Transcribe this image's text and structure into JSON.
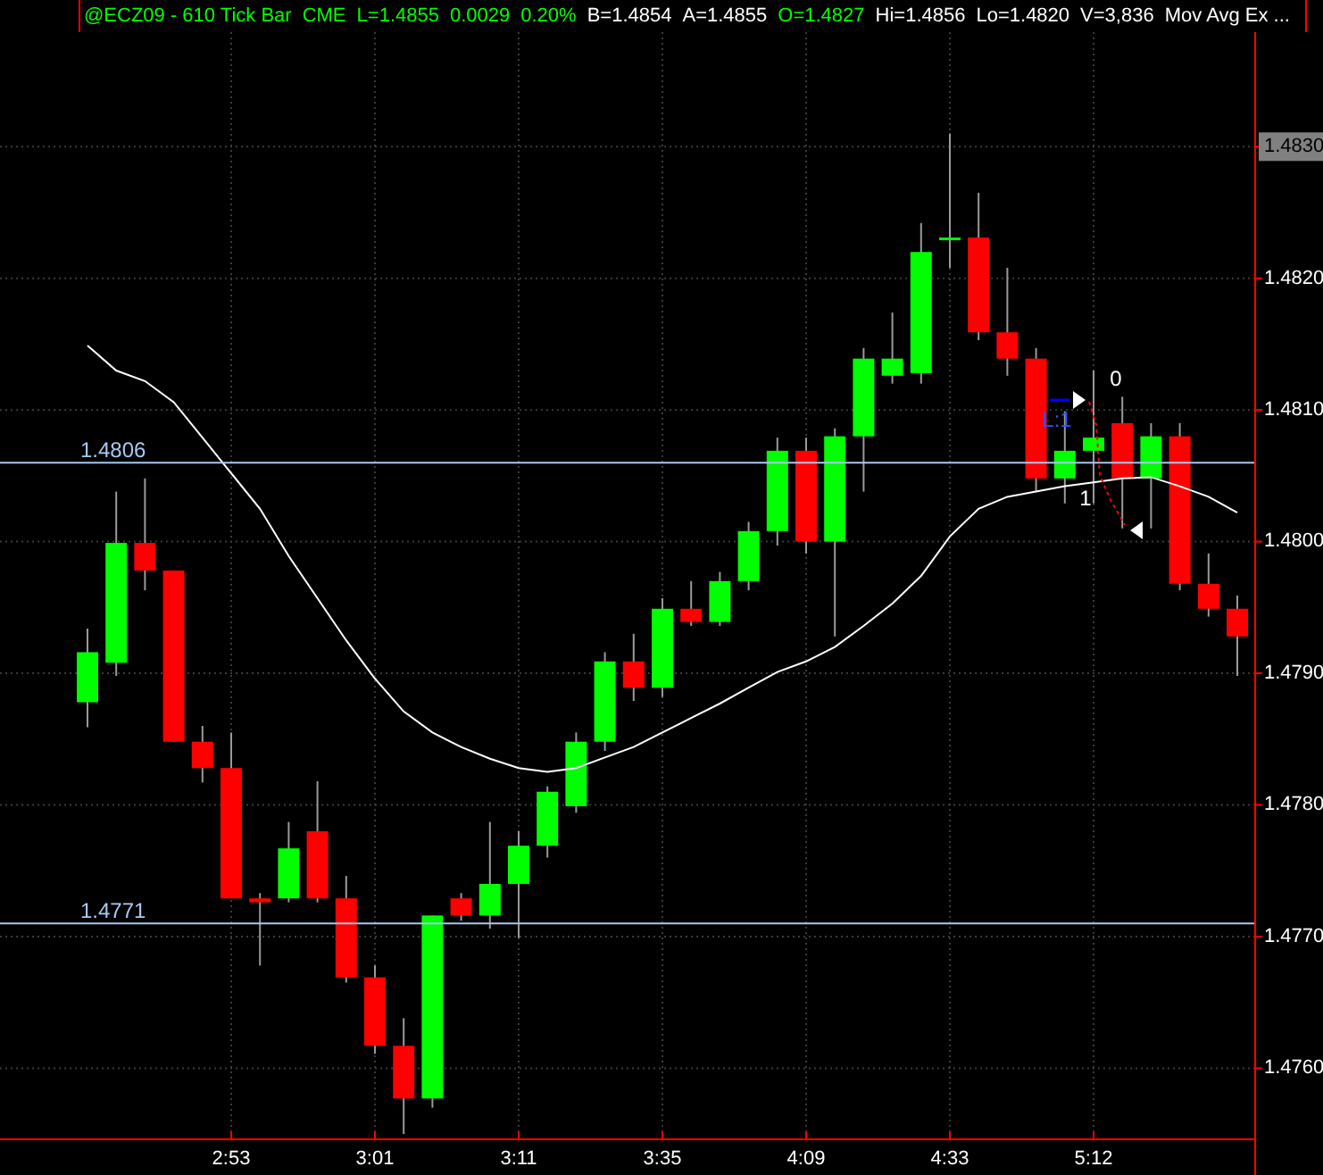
{
  "header": {
    "items": [
      {
        "text": "@ECZ09 - 610 Tick Bar",
        "color": "#00ff00"
      },
      {
        "text": "CME",
        "color": "#00ff00"
      },
      {
        "text": "L=1.4855",
        "color": "#00ff00"
      },
      {
        "text": "0.0029",
        "color": "#00ff00"
      },
      {
        "text": "0.20%",
        "color": "#00ff00"
      },
      {
        "text": "B=1.4854",
        "color": "#ffffff"
      },
      {
        "text": "A=1.4855",
        "color": "#ffffff"
      },
      {
        "text": "O=1.4827",
        "color": "#00ff00"
      },
      {
        "text": "Hi=1.4856",
        "color": "#ffffff"
      },
      {
        "text": "Lo=1.4820",
        "color": "#ffffff"
      },
      {
        "text": "V=3,836",
        "color": "#ffffff"
      },
      {
        "text": "Mov Avg Ex ...",
        "color": "#ffffff"
      }
    ]
  },
  "chart": {
    "chart_data": {
      "type": "candlestick",
      "ylim": [
        1.47546,
        1.48387
      ],
      "grid": true,
      "categories": [
        null,
        null,
        null,
        null,
        null,
        "2:53",
        null,
        null,
        null,
        null,
        "3:01",
        null,
        null,
        null,
        null,
        "3:11",
        null,
        null,
        null,
        null,
        "3:35",
        null,
        null,
        null,
        null,
        "4:09",
        null,
        null,
        null,
        null,
        "4:33",
        null,
        null,
        null,
        null,
        "5:12",
        null,
        null,
        null,
        null,
        null
      ],
      "yticks": [
        {
          "value": 1.476,
          "label": "1.4760"
        },
        {
          "value": 1.477,
          "label": "1.4770"
        },
        {
          "value": 1.478,
          "label": "1.4780"
        },
        {
          "value": 1.479,
          "label": "1.4790"
        },
        {
          "value": 1.48,
          "label": "1.4800"
        },
        {
          "value": 1.481,
          "label": "1.4810"
        },
        {
          "value": 1.482,
          "label": "1.4820"
        },
        {
          "value": 1.483,
          "label": "1.4830"
        }
      ],
      "ohlc": [
        [
          1.47878,
          1.47934,
          1.47859,
          1.47916
        ],
        [
          1.47908,
          1.48038,
          1.47898,
          1.47999
        ],
        [
          1.47999,
          1.48048,
          1.47963,
          1.47978
        ],
        [
          1.47978,
          1.47978,
          1.47848,
          1.47848
        ],
        [
          1.47848,
          1.4786,
          1.47817,
          1.47828
        ],
        [
          1.47828,
          1.47855,
          1.47729,
          1.47729
        ],
        [
          1.47729,
          1.47733,
          1.47678,
          1.47726
        ],
        [
          1.47729,
          1.47787,
          1.47726,
          1.47767
        ],
        [
          1.4778,
          1.47818,
          1.47726,
          1.47729
        ],
        [
          1.47729,
          1.47746,
          1.47665,
          1.47669
        ],
        [
          1.47669,
          1.47678,
          1.47611,
          1.47617
        ],
        [
          1.47617,
          1.47638,
          1.4755,
          1.47577
        ],
        [
          1.47577,
          1.47716,
          1.4757,
          1.47716
        ],
        [
          1.47729,
          1.47733,
          1.47712,
          1.47716
        ],
        [
          1.47716,
          1.47787,
          1.47706,
          1.4774
        ],
        [
          1.4774,
          1.4778,
          1.47699,
          1.47769
        ],
        [
          1.47769,
          1.47814,
          1.4776,
          1.4781
        ],
        [
          1.47799,
          1.47855,
          1.47794,
          1.47848
        ],
        [
          1.47848,
          1.47916,
          1.47841,
          1.47909
        ],
        [
          1.47909,
          1.4793,
          1.47879,
          1.47889
        ],
        [
          1.47889,
          1.47957,
          1.47882,
          1.47949
        ],
        [
          1.47949,
          1.4797,
          1.47936,
          1.47939
        ],
        [
          1.47939,
          1.47977,
          1.47936,
          1.4797
        ],
        [
          1.4797,
          1.48015,
          1.47963,
          1.48008
        ],
        [
          1.48008,
          1.48079,
          1.47997,
          1.48069
        ],
        [
          1.48069,
          1.48079,
          1.47991,
          1.48
        ],
        [
          1.48,
          1.48086,
          1.47928,
          1.4808
        ],
        [
          1.4808,
          1.48147,
          1.48038,
          1.48139
        ],
        [
          1.48126,
          1.48174,
          1.4812,
          1.48139
        ],
        [
          1.48128,
          1.48242,
          1.4812,
          1.4822
        ],
        [
          1.48229,
          1.4831,
          1.48208,
          1.48231
        ],
        [
          1.48231,
          1.48265,
          1.48153,
          1.48159
        ],
        [
          1.48159,
          1.48208,
          1.48126,
          1.48139
        ],
        [
          1.48139,
          1.48147,
          1.48038,
          1.48048
        ],
        [
          1.48048,
          1.48099,
          1.48029,
          1.48069
        ],
        [
          1.48069,
          1.4813,
          1.48029,
          1.48079
        ],
        [
          1.4809,
          1.4811,
          1.4801,
          1.48048
        ],
        [
          1.48048,
          1.4809,
          1.4801,
          1.4808
        ],
        [
          1.4808,
          1.4809,
          1.47963,
          1.47968
        ],
        [
          1.47968,
          1.47991,
          1.47943,
          1.47949
        ],
        [
          1.47949,
          1.47959,
          1.47898,
          1.47928
        ]
      ],
      "series": [
        {
          "type": "line",
          "color": "#ffffff",
          "values": [
            1.48149,
            1.4813,
            1.48122,
            1.48106,
            1.48079,
            1.48052,
            1.48025,
            1.47989,
            1.47957,
            1.47925,
            1.47896,
            1.47871,
            1.47855,
            1.47844,
            1.47835,
            1.47828,
            1.47825,
            1.47828,
            1.47836,
            1.47844,
            1.47855,
            1.47866,
            1.47877,
            1.47889,
            1.47901,
            1.47909,
            1.4792,
            1.47936,
            1.47953,
            1.47974,
            1.48004,
            1.48025,
            1.48034,
            1.48038,
            1.48042,
            1.48045,
            1.48048,
            1.48049,
            1.48042,
            1.48034,
            1.48022
          ]
        }
      ],
      "ref_lines": [
        {
          "axis": "y",
          "value": 1.4806,
          "label": "1.4806"
        },
        {
          "axis": "y",
          "value": 1.4771,
          "label": "1.4771"
        }
      ],
      "annotations": [
        "0",
        "1",
        "L:1"
      ]
    }
  }
}
